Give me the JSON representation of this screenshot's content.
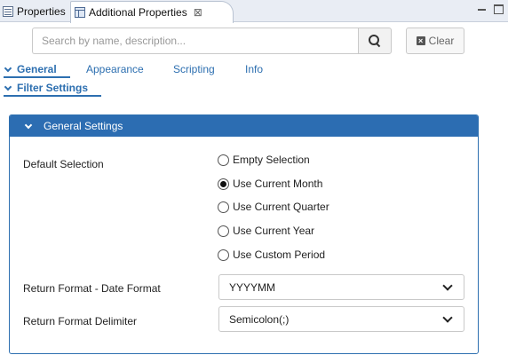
{
  "tabs": [
    {
      "label": "Properties",
      "icon": "properties-icon",
      "active": false
    },
    {
      "label": "Additional Properties",
      "icon": "additional-properties-icon",
      "active": true,
      "close_glyph": "⊠"
    }
  ],
  "search": {
    "placeholder": "Search by name, description...",
    "clear_label": "Clear"
  },
  "nav": {
    "general": "General",
    "appearance": "Appearance",
    "scripting": "Scripting",
    "info": "Info",
    "filter_settings": "Filter Settings"
  },
  "panel": {
    "title": "General Settings",
    "default_selection_label": "Default Selection",
    "options": [
      {
        "label": "Empty Selection",
        "checked": false
      },
      {
        "label": "Use Current Month",
        "checked": true
      },
      {
        "label": "Use Current Quarter",
        "checked": false
      },
      {
        "label": "Use Current Year",
        "checked": false
      },
      {
        "label": "Use Custom Period",
        "checked": false
      }
    ],
    "date_format_label": "Return Format - Date Format",
    "date_format_value": "YYYYMM",
    "delimiter_label": "Return Format Delimiter",
    "delimiter_value": "Semicolon(;)"
  },
  "colors": {
    "accent": "#2c6db2",
    "link": "#2d6fb0"
  }
}
